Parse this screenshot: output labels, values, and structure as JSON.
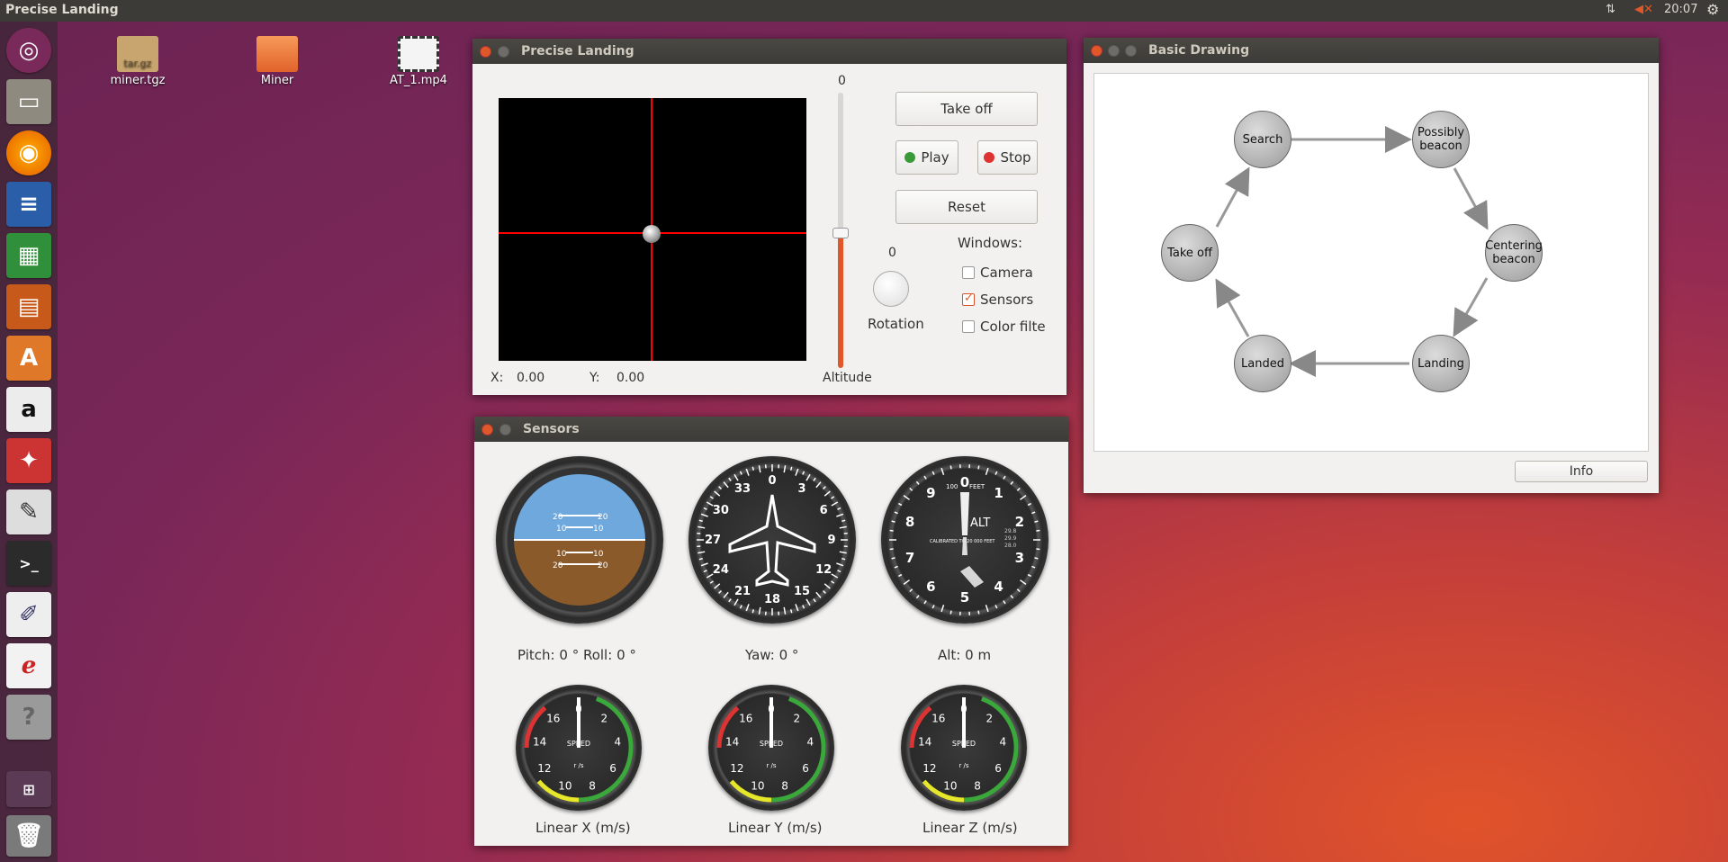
{
  "topbar": {
    "app_title": "Precise Landing",
    "time": "20:07"
  },
  "desktop": {
    "icons": [
      {
        "label": "miner.tgz",
        "sub": "tar.gz"
      },
      {
        "label": "Miner"
      },
      {
        "label": "AT_1.mp4"
      }
    ]
  },
  "launcher": [
    "ubuntu-icon",
    "files-icon",
    "firefox-icon",
    "writer-icon",
    "calc-icon",
    "impress-icon",
    "software-icon",
    "amazon-icon",
    "settings-icon",
    "editor-icon",
    "terminal-icon",
    "gimp-icon",
    "reader-icon",
    "help-icon",
    "workspaces-icon",
    "trash-icon"
  ],
  "landing": {
    "title": "Precise Landing",
    "slider_value": "0",
    "takeoff": "Take off",
    "play": "Play",
    "stop": "Stop",
    "reset": "Reset",
    "windows_label": "Windows:",
    "rotation_value": "0",
    "rotation_label": "Rotation",
    "altitude_label": "Altitude",
    "camera": "Camera",
    "sensors": "Sensors",
    "colorfilter": "Color filte",
    "x_label": "X:",
    "x_value": "0.00",
    "y_label": "Y:",
    "y_value": "0.00",
    "sensors_checked": true,
    "camera_checked": false,
    "colorfilter_checked": false
  },
  "sensors": {
    "title": "Sensors",
    "pitch_label": "Pitch:",
    "pitch_value": "0",
    "deg": "°",
    "roll_label": "Roll:",
    "roll_value": "0",
    "yaw_label": "Yaw:",
    "yaw_value": "0",
    "alt_label": "Alt:",
    "alt_value": "0",
    "alt_unit": "m",
    "linx": "Linear X (m/s)",
    "liny": "Linear Y (m/s)",
    "linz": "Linear Z (m/s)",
    "heading_ticks": [
      "0",
      "3",
      "6",
      "9",
      "12",
      "15",
      "18",
      "21",
      "24",
      "27",
      "30",
      "33"
    ],
    "alt_ticks": [
      "0",
      "1",
      "2",
      "3",
      "4",
      "5",
      "6",
      "7",
      "8",
      "9"
    ],
    "alt_text": "ALT",
    "alt_feet": "FEET",
    "alt_100": "100",
    "alt_cal": "CALIBRATED TO 20 000 FEET",
    "alt_side": [
      "29.8",
      "29.9",
      "28.0"
    ],
    "horizon_marks": [
      "20",
      "10",
      "10",
      "20"
    ],
    "speed_ticks": [
      "0",
      "2",
      "4",
      "6",
      "8",
      "10",
      "12",
      "14",
      "16"
    ],
    "speed_word": "SPEED",
    "speed_unit": "r /s"
  },
  "drawing": {
    "title": "Basic Drawing",
    "info": "Info",
    "nodes": [
      "Search",
      "Possibly beacon",
      "Centering beacon",
      "Landing",
      "Landed",
      "Take off"
    ]
  },
  "colors": {
    "accent": "#e0572a",
    "crosshair": "#ff0000",
    "sky": "#6fa8dc",
    "ground": "#8b5a2b"
  }
}
